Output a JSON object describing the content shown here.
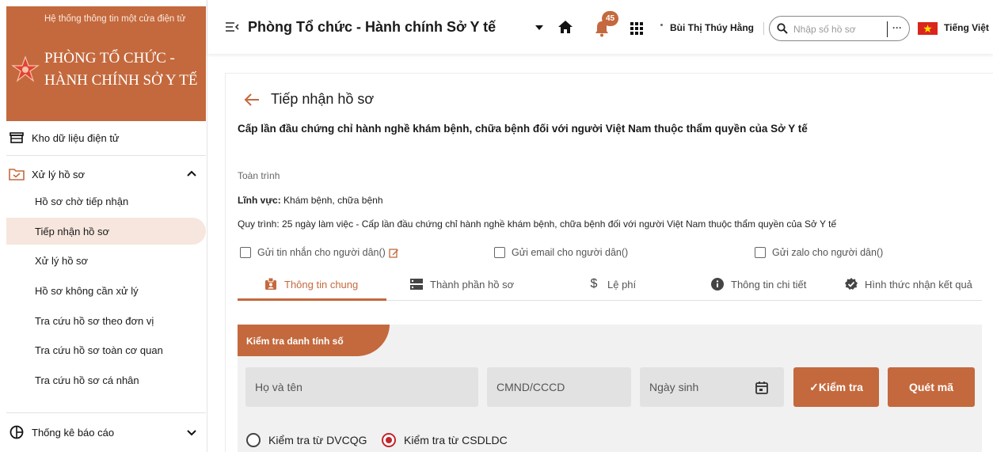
{
  "sidebar": {
    "brand_small": "Hệ thống thông tin một cửa điện tử",
    "brand_big": "PHÒNG TỔ CHỨC - HÀNH CHÍNH SỞ Y TẾ",
    "section_storage": "Kho dữ liệu điện tử",
    "section_process": "Xử lý hồ sơ",
    "items": [
      {
        "label": "Hồ sơ chờ tiếp nhận"
      },
      {
        "label": "Tiếp nhận hồ sơ"
      },
      {
        "label": "Xử lý hồ sơ"
      },
      {
        "label": "Hồ sơ không cần xử lý"
      },
      {
        "label": "Tra cứu hồ sơ theo đơn vị"
      },
      {
        "label": "Tra cứu hồ sơ toàn cơ quan"
      },
      {
        "label": "Tra cứu hồ sơ cá nhân"
      }
    ],
    "active_item": "Tiếp nhận hồ sơ",
    "section_reports": "Thống kê báo cáo"
  },
  "header": {
    "title": "Phòng Tổ chức - Hành chính Sở Y tế",
    "notification_count": "45",
    "user_name": "Bùi Thị Thúy Hằng",
    "search_placeholder": "Nhập số hồ sơ",
    "search_more": "···",
    "language": "Tiếng Việt"
  },
  "main": {
    "page_title": "Tiếp nhận hồ sơ",
    "procedure_title": "Cấp lần đầu chứng chỉ hành nghề khám bệnh, chữa bệnh đối với người Việt Nam thuộc thẩm quyền của Sở Y tế",
    "scope": "Toàn trình",
    "field_label": "Lĩnh vực:",
    "field_value": "Khám bệnh, chữa bệnh",
    "process_label": "Quy trình:",
    "process_value": "25 ngày làm việc - Cấp lần đầu chứng chỉ hành nghề khám bệnh, chữa bệnh đối với người Việt Nam thuộc thẩm quyền của Sở Y tế",
    "notify_sms": "Gửi tin nhắn cho người dân()",
    "notify_email": "Gửi email cho người dân()",
    "notify_zalo": "Gửi zalo cho người dân()",
    "tabs": [
      {
        "label": "Thông tin chung",
        "icon": "badge-icon"
      },
      {
        "label": "Thành phần hồ sơ",
        "icon": "document-list-icon"
      },
      {
        "label": "Lệ phí",
        "icon": "dollar-icon"
      },
      {
        "label": "Thông tin chi tiết",
        "icon": "info-icon"
      },
      {
        "label": "Hình thức nhận kết quả",
        "icon": "verified-icon"
      }
    ],
    "active_tab": "Thông tin chung",
    "panel_title": "Kiểm tra danh tính số",
    "name_placeholder": "Họ và tên",
    "id_placeholder": "CMND/CCCD",
    "dob_placeholder": "Ngày sinh",
    "check_button": "✓Kiểm tra",
    "scan_button": "Quét mã",
    "radio_dvcqg": "Kiểm tra từ DVCQG",
    "radio_csdldc": "Kiểm tra từ CSDLDC",
    "selected_radio": "Kiểm tra từ CSDLDC"
  },
  "colors": {
    "brand": "#c4693d",
    "active_bg": "#f7e6dd",
    "radio_selected": "#c4242b",
    "panel_bg": "#f1f1f1"
  }
}
